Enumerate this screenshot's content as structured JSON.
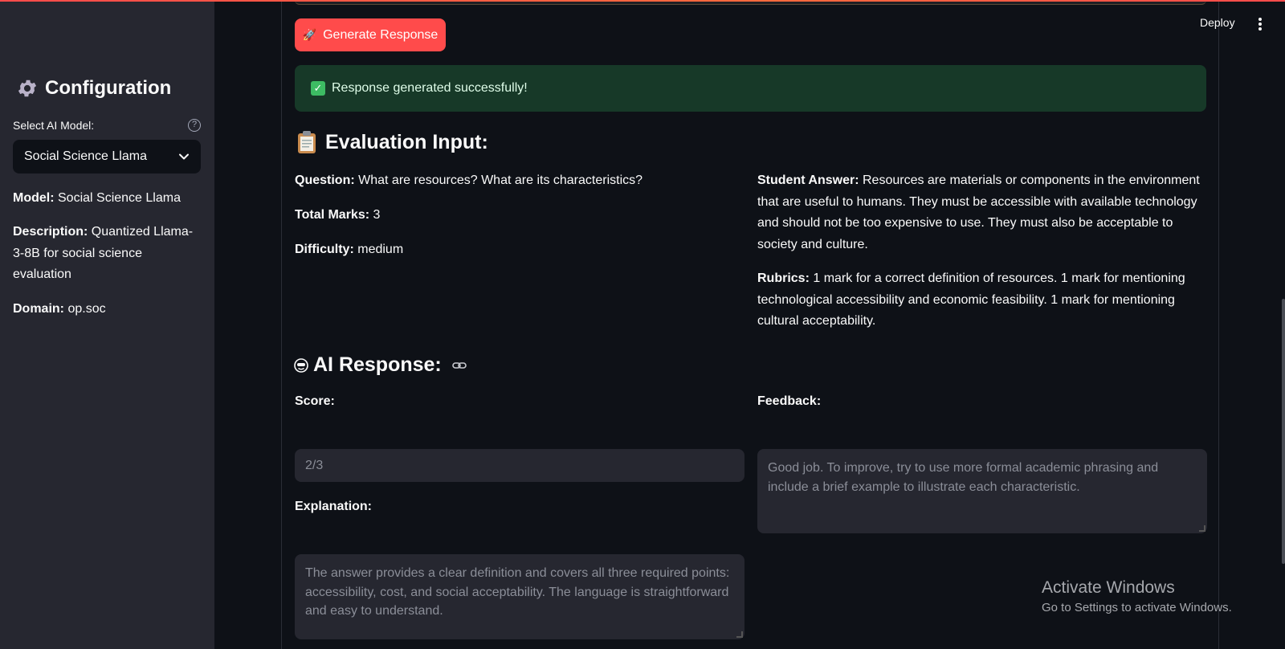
{
  "sidebar": {
    "title": "Configuration",
    "select_label": "Select AI Model:",
    "selected_model": "Social Science Llama",
    "model_label": "Model:",
    "model_value": "Social Science Llama",
    "description_label": "Description:",
    "description_value": "Quantized Llama-3-8B for social science evaluation",
    "domain_label": "Domain:",
    "domain_value": "op.soc"
  },
  "header": {
    "deploy_label": "Deploy"
  },
  "main": {
    "generate_button": "Generate Response",
    "success_message": "Response generated successfully!",
    "evaluation_heading": "Evaluation Input:",
    "question_label": "Question:",
    "question_value": "What are resources? What are its characteristics?",
    "total_marks_label": "Total Marks:",
    "total_marks_value": "3",
    "difficulty_label": "Difficulty:",
    "difficulty_value": "medium",
    "student_answer_label": "Student Answer:",
    "student_answer_value": "Resources are materials or components in the environment that are useful to humans. They must be accessible with available technology and should not be too expensive to use. They must also be acceptable to society and culture.",
    "rubrics_label": "Rubrics:",
    "rubrics_value": "1 mark for a correct definition of resources. 1 mark for mentioning technological accessibility and economic feasibility. 1 mark for mentioning cultural acceptability.",
    "ai_heading": "AI Response:",
    "score_label": "Score:",
    "score_value": "2/3",
    "feedback_label": "Feedback:",
    "feedback_value": "Good job. To improve, try to use more formal academic phrasing and include a brief example to illustrate each characteristic.",
    "explanation_label": "Explanation:",
    "explanation_value": "The answer provides a clear definition and covers all three required points: accessibility, cost, and social acceptability. The language is straightforward and easy to understand."
  },
  "watermark": {
    "title": "Activate Windows",
    "subtitle": "Go to Settings to activate Windows."
  },
  "colors": {
    "primary": "#ff4b4b",
    "background": "#0e1117",
    "sidebar": "#262730",
    "success_bg": "#173928"
  }
}
